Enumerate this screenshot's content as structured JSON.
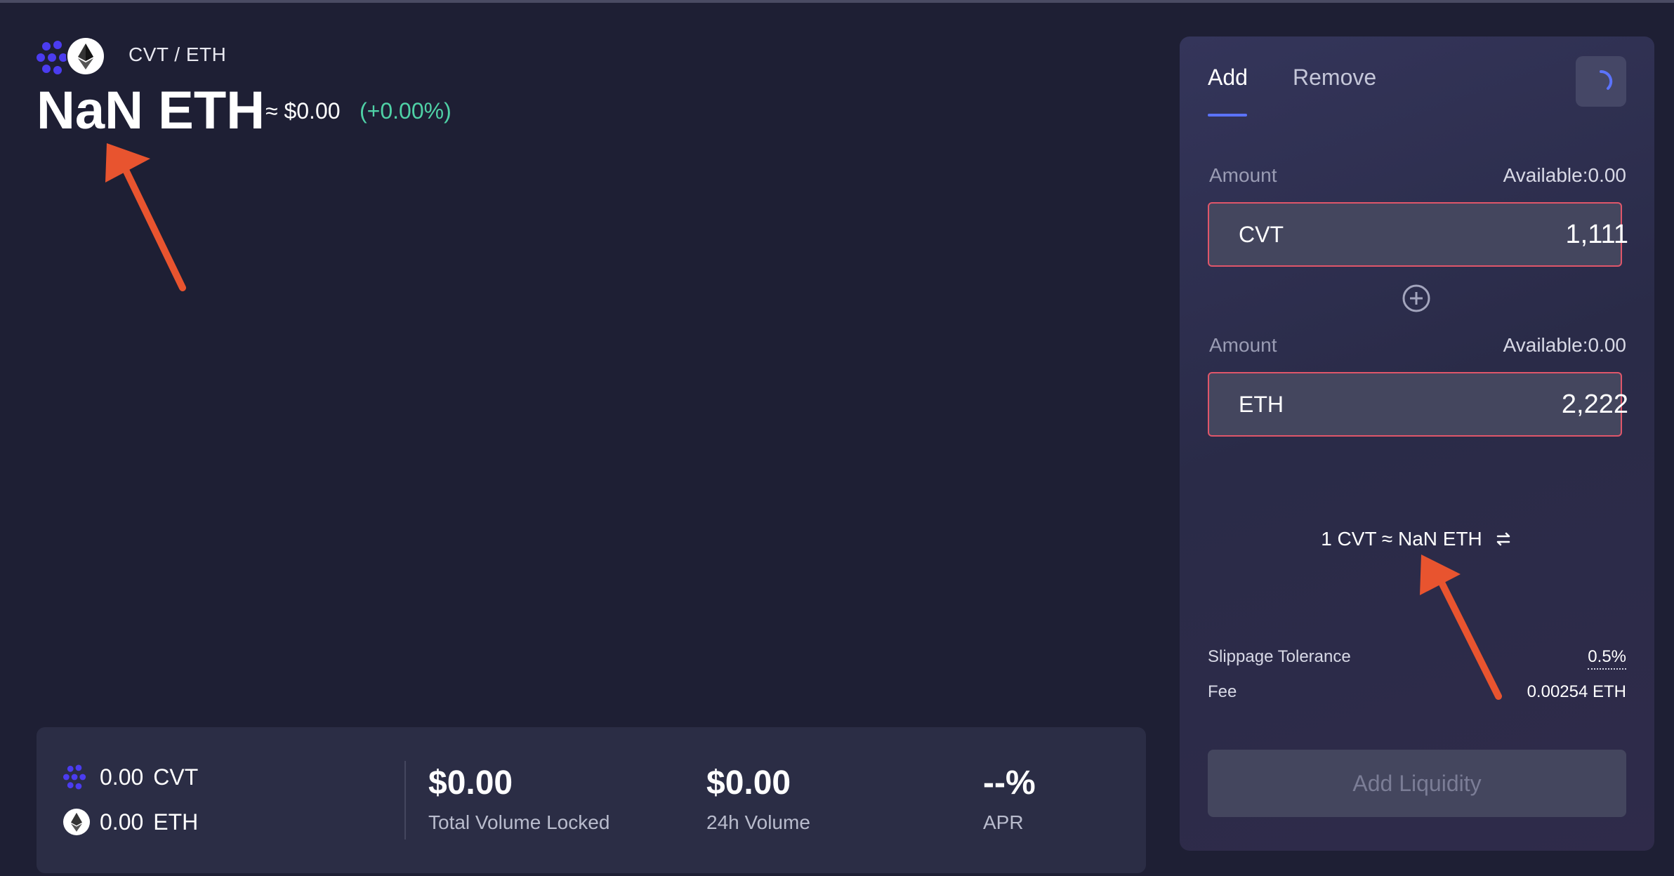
{
  "header": {
    "pair": "CVT / ETH",
    "price": "NaN ETH",
    "price_usd": "≈ $0.00",
    "change": "(+0.00%)"
  },
  "stats": {
    "cvt_amount": "0.00",
    "cvt_symbol": "CVT",
    "eth_amount": "0.00",
    "eth_symbol": "ETH",
    "tvl_value": "$0.00",
    "tvl_label": "Total Volume Locked",
    "volume_value": "$0.00",
    "volume_label": "24h Volume",
    "apr_value": "--%",
    "apr_label": "APR"
  },
  "panel": {
    "tab_add": "Add",
    "tab_remove": "Remove",
    "amount_label_1": "Amount",
    "available_1": "Available:0.00",
    "token_1": "CVT",
    "value_1": "1,111",
    "amount_label_2": "Amount",
    "available_2": "Available:0.00",
    "token_2": "ETH",
    "value_2": "2,222",
    "rate": "1 CVT ≈ NaN ETH",
    "slippage_label": "Slippage Tolerance",
    "slippage_value": "0.5%",
    "fee_label": "Fee",
    "fee_value": "0.00254 ETH",
    "add_liquidity": "Add Liquidity"
  },
  "colors": {
    "background": "#1e1f34",
    "accent": "#5b73ff",
    "positive": "#4fd1a6",
    "error_border": "#e0566a",
    "annotation_arrow": "#e8542f"
  },
  "icons": [
    "cvt-logo-icon",
    "eth-logo-icon",
    "settings-spinner-icon",
    "plus-circle-icon",
    "swap-arrows-icon"
  ]
}
